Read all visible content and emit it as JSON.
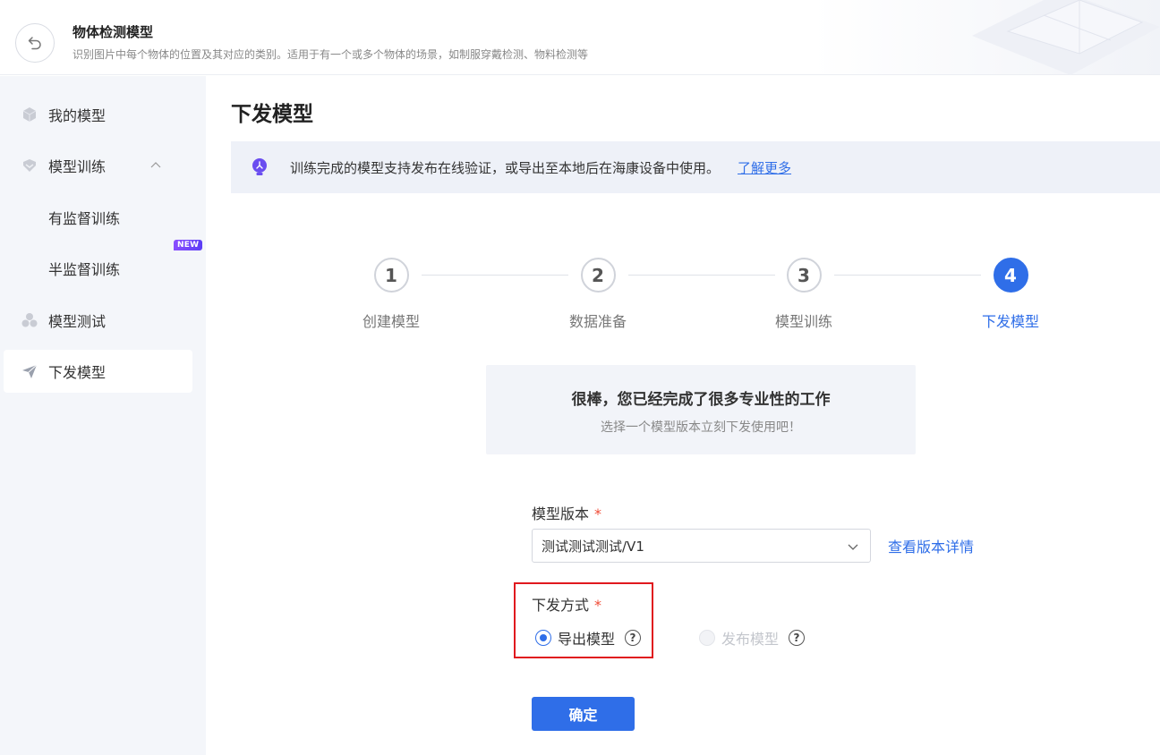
{
  "header": {
    "title": "物体检测模型",
    "description": "识别图片中每个物体的位置及其对应的类别。适用于有一个或多个物体的场景，如制服穿戴检测、物料检测等"
  },
  "sidebar": {
    "items": [
      {
        "label": "我的模型",
        "icon": "cube-icon"
      },
      {
        "label": "模型训练",
        "icon": "shield-icon",
        "expanded": true
      },
      {
        "label": "有监督训练"
      },
      {
        "label": "半监督训练",
        "badge": "NEW"
      },
      {
        "label": "模型测试",
        "icon": "cluster-icon"
      },
      {
        "label": "下发模型",
        "icon": "send-icon",
        "active": true
      }
    ]
  },
  "main": {
    "page_title": "下发模型",
    "banner": {
      "text": "训练完成的模型支持发布在线验证，或导出至本地后在海康设备中使用。",
      "link": "了解更多"
    },
    "steps": [
      {
        "number": "1",
        "label": "创建模型"
      },
      {
        "number": "2",
        "label": "数据准备"
      },
      {
        "number": "3",
        "label": "模型训练"
      },
      {
        "number": "4",
        "label": "下发模型",
        "active": true
      }
    ],
    "card": {
      "title": "很棒，您已经完成了很多专业性的工作",
      "subtitle": "选择一个模型版本立刻下发使用吧！"
    },
    "form": {
      "version_label": "模型版本",
      "required_mark": "*",
      "version_value": "测试测试测试/V1",
      "version_detail_link": "查看版本详情",
      "method_label": "下发方式",
      "option_export": "导出模型",
      "option_publish": "发布模型",
      "help_symbol": "?",
      "confirm": "确定"
    }
  },
  "colors": {
    "accent": "#2f6ee8",
    "required": "#f04b36",
    "highlight_box": "#e0191e",
    "badge_gradient_start": "#8a4dff"
  }
}
